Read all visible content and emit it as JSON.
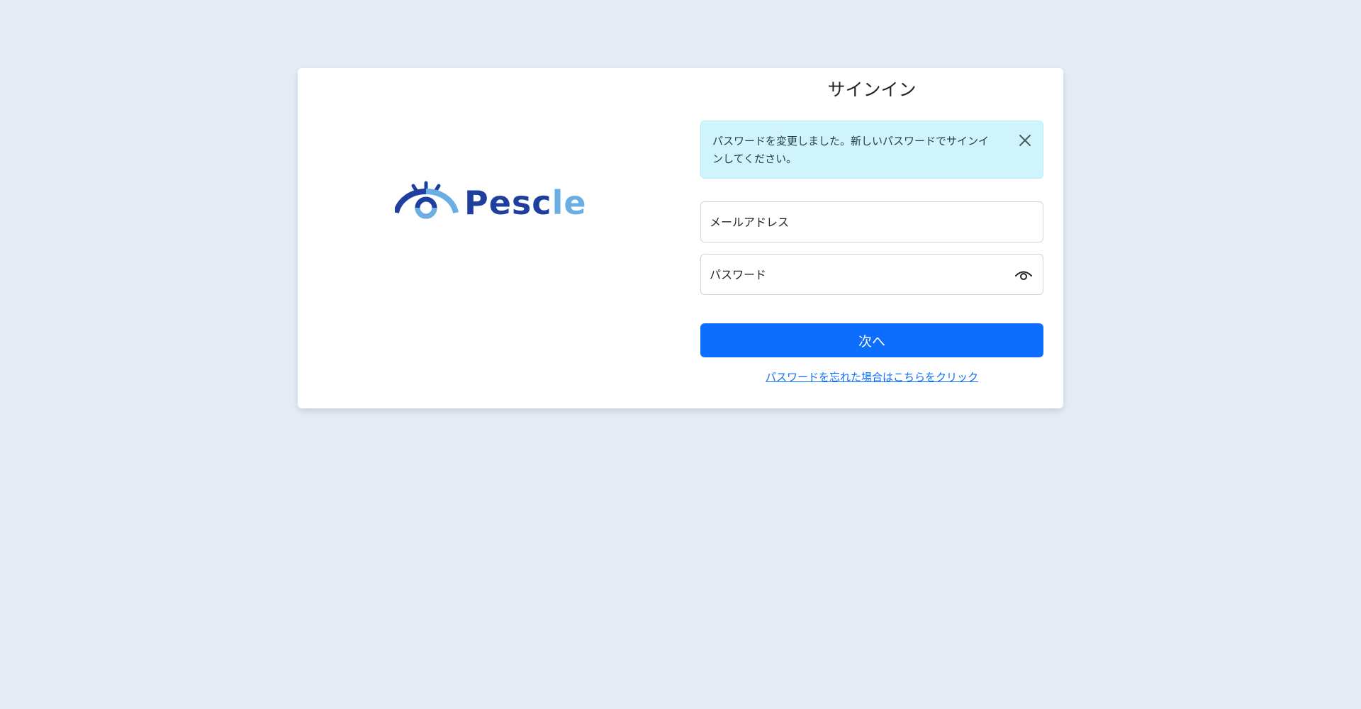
{
  "brand": {
    "name": "Pesc",
    "name_accent": "le",
    "primary_color": "#1f3f9e",
    "accent_color": "#6aaee3"
  },
  "signin": {
    "title": "サインイン",
    "alert_message": "パスワードを変更しました。新しいパスワードでサインインしてください。",
    "email_placeholder": "メールアドレス",
    "email_value": "",
    "password_placeholder": "パスワード",
    "password_value": "",
    "next_label": "次へ",
    "forgot_link": "パスワードを忘れた場合はこちらをクリック"
  },
  "icons": {
    "close": "close-icon",
    "toggle_password": "eye-icon"
  },
  "colors": {
    "background": "#e5ecf6",
    "primary_button": "#0d6efd",
    "alert_background": "#cff4fc"
  }
}
